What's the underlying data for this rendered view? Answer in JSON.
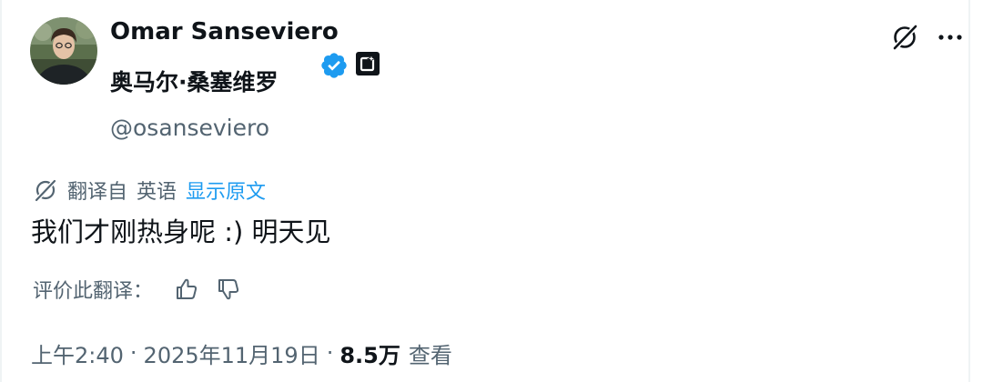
{
  "author": {
    "display_name": "Omar Sanseviero",
    "display_name_localized": "奥马尔·桑塞维罗",
    "handle": "@osanseviero"
  },
  "icons": {
    "verified": "verified-badge-icon",
    "affiliate": "affiliate-badge-icon",
    "grok": "grok-icon",
    "more": "more-options-icon",
    "translate": "translate-icon",
    "thumbs_up": "thumbs-up-icon",
    "thumbs_down": "thumbs-down-icon"
  },
  "colors": {
    "accent": "#1d9bf0",
    "text": "#0f1419",
    "secondary": "#536471"
  },
  "translation": {
    "source_label": "翻译自",
    "language": "英语",
    "show_original": "显示原文",
    "rate_label": "评价此翻译："
  },
  "tweet": {
    "text": "我们才刚热身呢 :) 明天见",
    "time": "上午2:40",
    "date": "2025年11月19日",
    "views_count": "8.5万",
    "views_label": "查看"
  }
}
